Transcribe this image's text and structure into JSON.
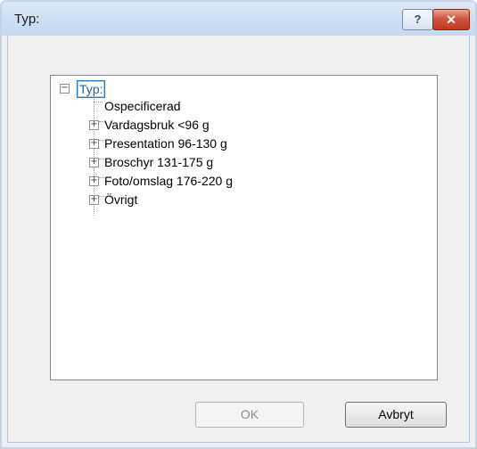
{
  "window": {
    "title": "Typ:",
    "help_glyph": "?",
    "close_glyph": "✕"
  },
  "tree": {
    "root": {
      "label": "Typ:",
      "expander": "−"
    },
    "items": [
      {
        "label": "Ospecificerad",
        "expander": ""
      },
      {
        "label": "Vardagsbruk <96 g",
        "expander": "+"
      },
      {
        "label": "Presentation 96-130 g",
        "expander": "+"
      },
      {
        "label": "Broschyr 131-175 g",
        "expander": "+"
      },
      {
        "label": "Foto/omslag 176-220 g",
        "expander": "+"
      },
      {
        "label": "Övrigt",
        "expander": "+"
      }
    ]
  },
  "buttons": {
    "ok": "OK",
    "cancel": "Avbryt"
  }
}
